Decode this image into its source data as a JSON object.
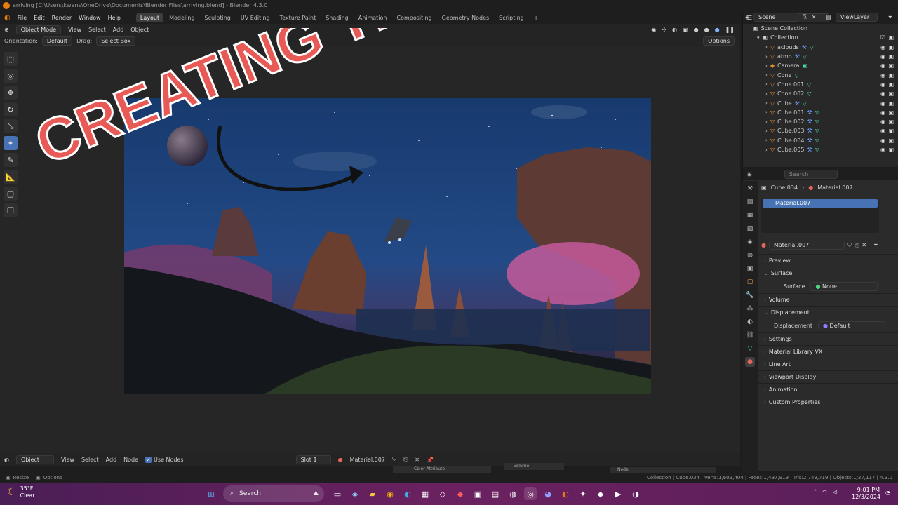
{
  "window": {
    "title": "arriving [C:\\Users\\kwans\\OneDrive\\Documents\\Blender Files\\arriving.blend] - Blender 4.3.0"
  },
  "menu": [
    "File",
    "Edit",
    "Render",
    "Window",
    "Help"
  ],
  "workspaces": [
    "Layout",
    "Modeling",
    "Sculpting",
    "UV Editing",
    "Texture Paint",
    "Shading",
    "Animation",
    "Compositing",
    "Geometry Nodes",
    "Scripting"
  ],
  "active_workspace": "Layout",
  "scene": {
    "label": "Scene",
    "view_layer": "ViewLayer"
  },
  "viewport": {
    "mode": "Object Mode",
    "menus": [
      "View",
      "Select",
      "Add",
      "Object"
    ],
    "orientation_label": "Orientation:",
    "orientation_value": "Default",
    "drag_label": "Drag:",
    "drag_value": "Select Box",
    "options": "Options"
  },
  "overlay": {
    "headline": "CREATING THIS!!",
    "text_color": "#e85a55"
  },
  "outliner": {
    "search_placeholder": "Search",
    "scene_collection": "Scene Collection",
    "collection": "Collection",
    "items": [
      {
        "name": "aclouds",
        "icon": "mesh-icon"
      },
      {
        "name": "atmo",
        "icon": "mesh-icon"
      },
      {
        "name": "Camera",
        "icon": "camera-icon"
      },
      {
        "name": "Cone",
        "icon": "mesh-icon"
      },
      {
        "name": "Cone.001",
        "icon": "mesh-icon"
      },
      {
        "name": "Cone.002",
        "icon": "mesh-icon"
      },
      {
        "name": "Cube",
        "icon": "mesh-icon"
      },
      {
        "name": "Cube.001",
        "icon": "mesh-icon"
      },
      {
        "name": "Cube.002",
        "icon": "mesh-icon"
      },
      {
        "name": "Cube.003",
        "icon": "mesh-icon"
      },
      {
        "name": "Cube.004",
        "icon": "mesh-icon"
      },
      {
        "name": "Cube.005",
        "icon": "mesh-icon"
      }
    ]
  },
  "properties": {
    "search_placeholder": "Search",
    "object": "Cube.034",
    "material": "Material.007",
    "slot_name": "Material.007",
    "material_field": "Material.007",
    "panels": [
      {
        "label": "Preview",
        "open": false
      },
      {
        "label": "Surface",
        "open": true,
        "field_label": "Surface",
        "field_value": "None"
      },
      {
        "label": "Volume",
        "open": false
      },
      {
        "label": "Displacement",
        "open": true,
        "field_label": "Displacement",
        "field_value": "Default"
      },
      {
        "label": "Settings",
        "open": false
      },
      {
        "label": "Material Library VX",
        "open": false
      },
      {
        "label": "Line Art",
        "open": false
      },
      {
        "label": "Viewport Display",
        "open": false
      },
      {
        "label": "Animation",
        "open": false
      },
      {
        "label": "Custom Properties",
        "open": false
      }
    ]
  },
  "node_editor": {
    "mode": "Object",
    "menus": [
      "View",
      "Select",
      "Add",
      "Node"
    ],
    "use_nodes": "Use Nodes",
    "slot": "Slot 1",
    "material": "Material.007",
    "node_a": "Color Attribute",
    "node_b": "Volume",
    "node_c": "Node"
  },
  "status": {
    "left_a": "Resize",
    "left_b": "Options",
    "right": "Collection | Cube.034 | Verts:1,609,404 | Faces:1,497,919 | Tris:2,749,719 | Objects:1/27,117 | 4.3.0"
  },
  "taskbar": {
    "weather_temp": "35°F",
    "weather_text": "Clear",
    "search": "Search",
    "time": "9:01 PM",
    "date": "12/3/2024"
  }
}
